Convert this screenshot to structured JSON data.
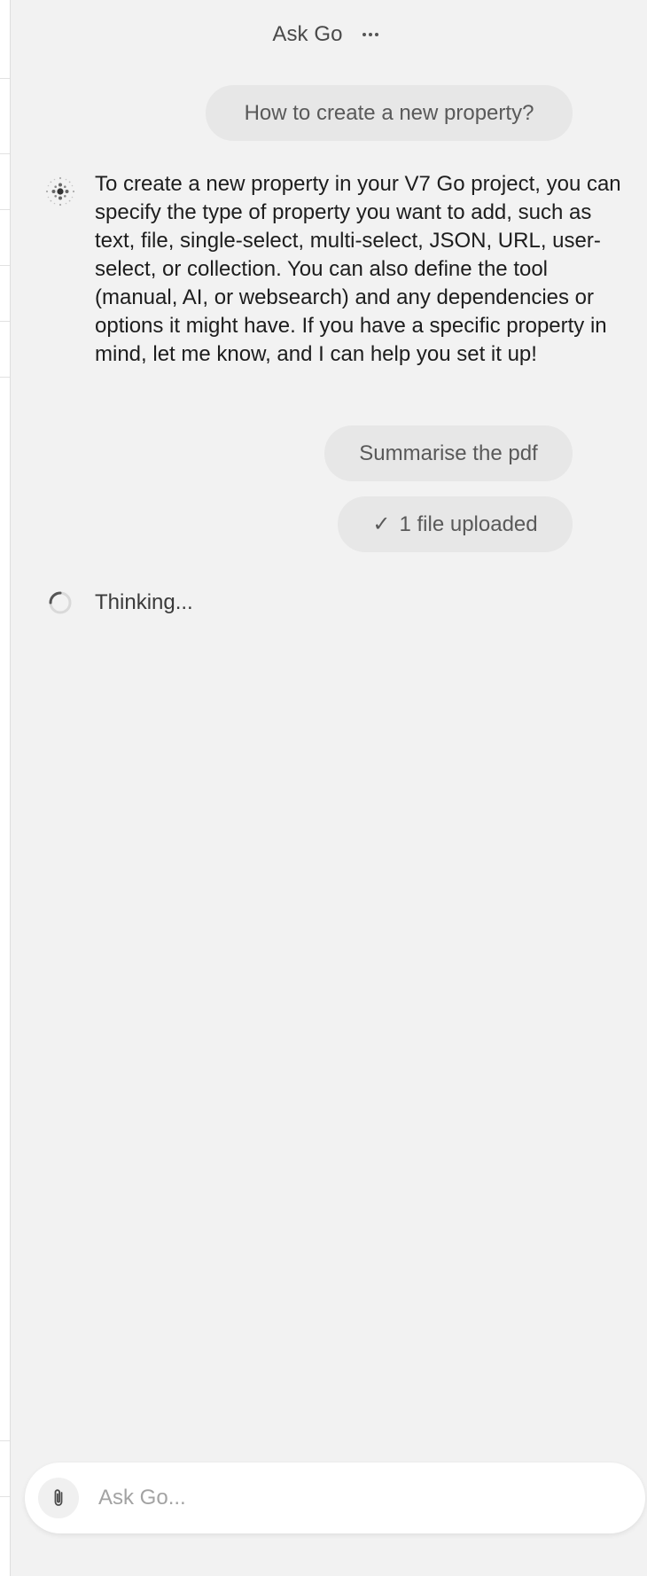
{
  "header": {
    "title": "Ask Go",
    "more_icon": "more-horizontal-icon"
  },
  "conversation": {
    "messages": [
      {
        "role": "user",
        "text": "How to create a new property?"
      },
      {
        "role": "assistant",
        "avatar_icon": "sparkle-dots-icon",
        "text": "To create a new property in your V7 Go project, you can specify the type of property you want to add, such as text, file, single-select, multi-select, JSON, URL, user-select, or collection. You can also define the tool (manual, AI, or websearch) and any dependencies or options it might have. If you have a specific property in mind, let me know, and I can help you set it up!"
      },
      {
        "role": "user",
        "text": "Summarise the pdf"
      },
      {
        "role": "user-attachment",
        "check_glyph": "✓",
        "text": "1 file uploaded"
      }
    ],
    "status": {
      "spinner_icon": "loading-spinner-icon",
      "text": "Thinking..."
    }
  },
  "composer": {
    "attach_icon": "paperclip-icon",
    "placeholder": "Ask Go...",
    "value": ""
  },
  "colors": {
    "panel_bg": "#f2f2f2",
    "bubble_bg": "#e7e7e7",
    "composer_bg": "#ffffff"
  }
}
